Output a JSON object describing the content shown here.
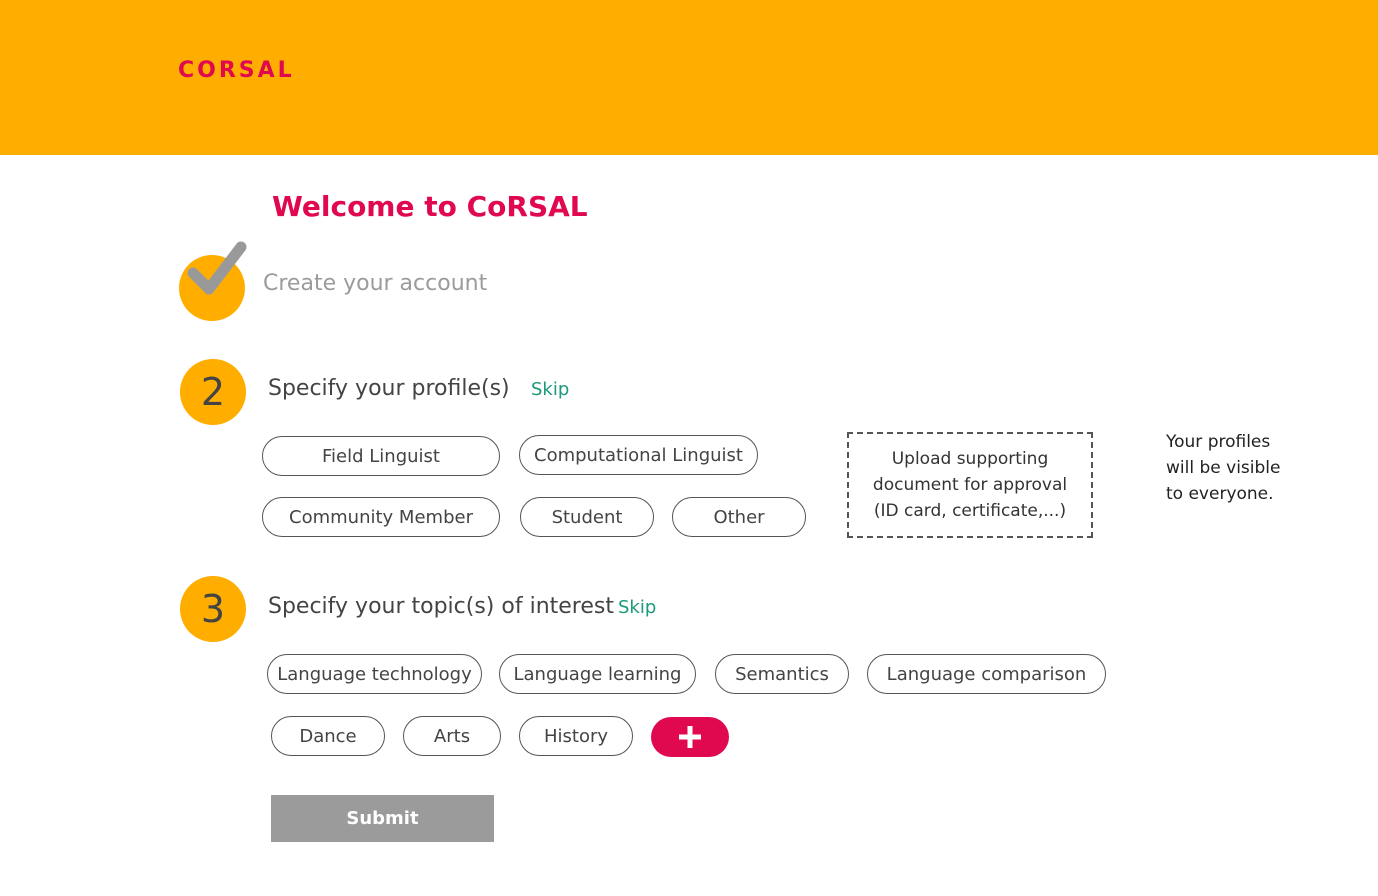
{
  "header": {
    "logo": "CORSAL"
  },
  "welcome_title": "Welcome to CoRSAL",
  "steps": [
    {
      "status": "completed",
      "label": "Create your account"
    },
    {
      "number": "2",
      "label": "Specify your profile(s)",
      "skip_label": "Skip"
    },
    {
      "number": "3",
      "label": "Specify your topic(s) of interest",
      "skip_label": "Skip"
    }
  ],
  "profiles": [
    "Field Linguist",
    "Computational Linguist",
    "Community Member",
    "Student",
    "Other"
  ],
  "upload": {
    "label": "Upload supporting\ndocument for approval\n(ID card, certificate,...)"
  },
  "profile_note": "Your profiles\nwill be visible\nto everyone.",
  "topics": [
    "Language technology",
    "Language learning",
    "Semantics",
    "Language comparison",
    "Dance",
    "Arts",
    "History"
  ],
  "add_topic_icon": "plus-icon",
  "submit_label": "Submit",
  "colors": {
    "header": "#FFAE00",
    "accent": "#E0094F",
    "skip": "#1A9A7A",
    "submit": "#9b9b9b"
  }
}
